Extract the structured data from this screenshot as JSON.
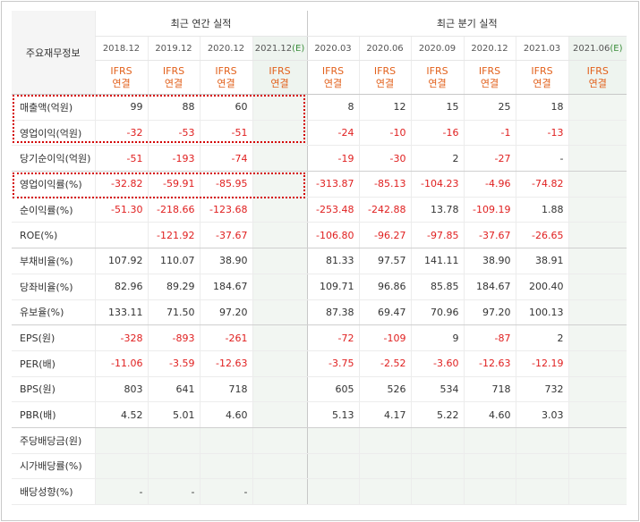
{
  "header": {
    "row_label": "주요재무정보",
    "annual_title": "최근 연간 실적",
    "quarter_title": "최근 분기 실적",
    "annual_periods": [
      "2018.12",
      "2019.12",
      "2020.12",
      "2021.12"
    ],
    "quarter_periods": [
      "2020.03",
      "2020.06",
      "2020.09",
      "2020.12",
      "2021.03",
      "2021.06"
    ],
    "estimate_mark": "(E)",
    "ifrs": "IFRS",
    "consolidated": "연결"
  },
  "rows": [
    {
      "label": "매출액(억원)",
      "values": [
        "99",
        "88",
        "60",
        "",
        "8",
        "12",
        "15",
        "25",
        "18",
        ""
      ]
    },
    {
      "label": "영업이익(억원)",
      "values": [
        "-32",
        "-53",
        "-51",
        "",
        "-24",
        "-10",
        "-16",
        "-1",
        "-13",
        ""
      ]
    },
    {
      "label": "당기순이익(억원)",
      "values": [
        "-51",
        "-193",
        "-74",
        "",
        "-19",
        "-30",
        "2",
        "-27",
        "-",
        ""
      ]
    },
    {
      "label": "영업이익률(%)",
      "values": [
        "-32.82",
        "-59.91",
        "-85.95",
        "",
        "-313.87",
        "-85.13",
        "-104.23",
        "-4.96",
        "-74.82",
        ""
      ]
    },
    {
      "label": "순이익률(%)",
      "values": [
        "-51.30",
        "-218.66",
        "-123.68",
        "",
        "-253.48",
        "-242.88",
        "13.78",
        "-109.19",
        "1.88",
        ""
      ]
    },
    {
      "label": "ROE(%)",
      "values": [
        "",
        "-121.92",
        "-37.67",
        "",
        "-106.80",
        "-96.27",
        "-97.85",
        "-37.67",
        "-26.65",
        ""
      ]
    },
    {
      "label": "부채비율(%)",
      "values": [
        "107.92",
        "110.07",
        "38.90",
        "",
        "81.33",
        "97.57",
        "141.11",
        "38.90",
        "38.91",
        ""
      ]
    },
    {
      "label": "당좌비율(%)",
      "values": [
        "82.96",
        "89.29",
        "184.67",
        "",
        "109.71",
        "96.86",
        "85.85",
        "184.67",
        "200.40",
        ""
      ]
    },
    {
      "label": "유보율(%)",
      "values": [
        "133.11",
        "71.50",
        "97.20",
        "",
        "87.38",
        "69.47",
        "70.96",
        "97.20",
        "100.13",
        ""
      ]
    },
    {
      "label": "EPS(원)",
      "values": [
        "-328",
        "-893",
        "-261",
        "",
        "-72",
        "-109",
        "9",
        "-87",
        "2",
        ""
      ]
    },
    {
      "label": "PER(배)",
      "values": [
        "-11.06",
        "-3.59",
        "-12.63",
        "",
        "-3.75",
        "-2.52",
        "-3.60",
        "-12.63",
        "-12.19",
        ""
      ]
    },
    {
      "label": "BPS(원)",
      "values": [
        "803",
        "641",
        "718",
        "",
        "605",
        "526",
        "534",
        "718",
        "732",
        ""
      ]
    },
    {
      "label": "PBR(배)",
      "values": [
        "4.52",
        "5.01",
        "4.60",
        "",
        "5.13",
        "4.17",
        "5.22",
        "4.60",
        "3.03",
        ""
      ]
    },
    {
      "label": "주당배당금(원)",
      "values": [
        "",
        "",
        "",
        "",
        "",
        "",
        "",
        "",
        "",
        ""
      ]
    },
    {
      "label": "시가배당률(%)",
      "values": [
        "",
        "",
        "",
        "",
        "",
        "",
        "",
        "",
        "",
        ""
      ]
    },
    {
      "label": "배당성향(%)",
      "values": [
        "-",
        "-",
        "-",
        "",
        "",
        "",
        "",
        "",
        "",
        ""
      ]
    }
  ],
  "colors": {
    "negative": "#e02020",
    "ifrs_orange": "#e2611c",
    "estimate_green": "#3a8d3a",
    "highlight_box": "#d40000"
  }
}
